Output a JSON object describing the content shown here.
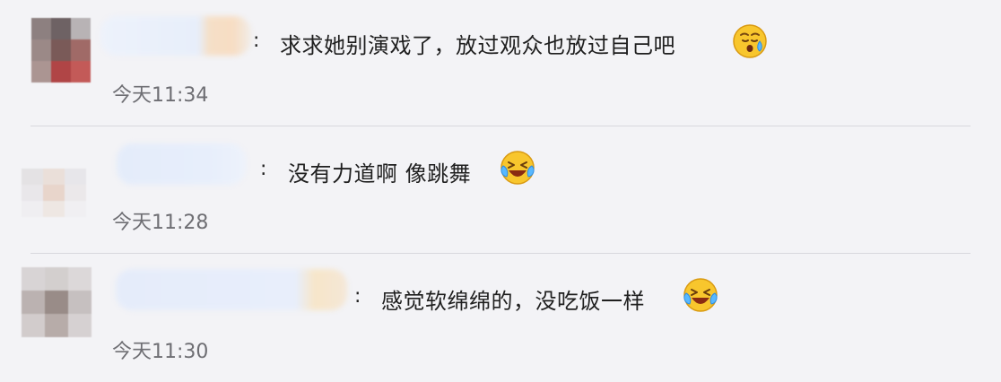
{
  "comments": [
    {
      "colon": ":",
      "text": "求求她别演戏了，放过观众也放过自己吧",
      "emoji": "sweat-face-icon",
      "time": "今天11:34"
    },
    {
      "colon": ":",
      "text": "没有力道啊 像跳舞",
      "emoji": "crying-laughing-icon",
      "time": "今天11:28"
    },
    {
      "colon": ":",
      "text": "感觉软绵绵的，没吃饭一样",
      "emoji": "crying-laughing-icon",
      "time": "今天11:30"
    }
  ],
  "colors": {
    "background": "#f3f3f6",
    "text": "#1f1f1f",
    "time": "#6e6e73",
    "emoji_face": "#f8c62d"
  }
}
